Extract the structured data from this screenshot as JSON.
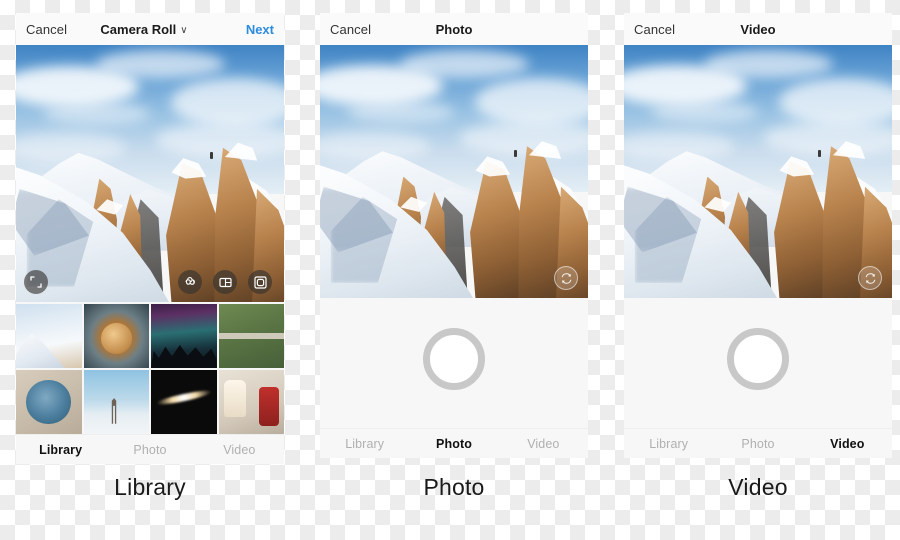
{
  "panels": [
    {
      "id": "library",
      "navbar": {
        "cancel": "Cancel",
        "title": "Camera Roll",
        "caret": "∨",
        "next": "Next"
      },
      "overlay_buttons": [
        {
          "name": "expand-icon",
          "label": "expand"
        },
        {
          "name": "boomerang-icon",
          "label": "∞"
        },
        {
          "name": "layout-icon",
          "label": "layout"
        },
        {
          "name": "multi-select-icon",
          "label": "multi-select"
        }
      ],
      "thumbnails": [
        {
          "name": "thumb-mountain",
          "alt": "snowy mountain"
        },
        {
          "name": "thumb-food-plate",
          "alt": "fried food on plate"
        },
        {
          "name": "thumb-aurora",
          "alt": "aurora over pine forest"
        },
        {
          "name": "thumb-aerial-path",
          "alt": "aerial view of path"
        },
        {
          "name": "thumb-salad-bowl",
          "alt": "salad bowl"
        },
        {
          "name": "thumb-bridge-fog",
          "alt": "bridge in fog"
        },
        {
          "name": "thumb-light-trail",
          "alt": "light trail at night"
        },
        {
          "name": "thumb-christmas",
          "alt": "christmas drinks"
        }
      ],
      "tabs": [
        {
          "label": "Library",
          "active": true
        },
        {
          "label": "Photo",
          "active": false
        },
        {
          "label": "Video",
          "active": false
        }
      ],
      "caption": "Library"
    },
    {
      "id": "photo",
      "navbar": {
        "cancel": "Cancel",
        "title": "Photo",
        "caret": "",
        "next": ""
      },
      "shutter": "shutter-button",
      "flip_icon": "camera-flip-icon",
      "tabs": [
        {
          "label": "Library",
          "active": false
        },
        {
          "label": "Photo",
          "active": true
        },
        {
          "label": "Video",
          "active": false
        }
      ],
      "caption": "Photo"
    },
    {
      "id": "video",
      "navbar": {
        "cancel": "Cancel",
        "title": "Video",
        "caret": "",
        "next": ""
      },
      "shutter": "record-button",
      "flip_icon": "camera-flip-icon",
      "tabs": [
        {
          "label": "Library",
          "active": false
        },
        {
          "label": "Photo",
          "active": false
        },
        {
          "label": "Video",
          "active": true
        }
      ],
      "caption": "Video"
    }
  ],
  "colors": {
    "accent_next": "#2b8ce0",
    "panel_bg": "#f7f7f7",
    "navbar_bg": "#fafafa",
    "tab_inactive": "#b0b0b0",
    "tab_active": "#111111",
    "shutter_ring": "#c8c8c8"
  }
}
